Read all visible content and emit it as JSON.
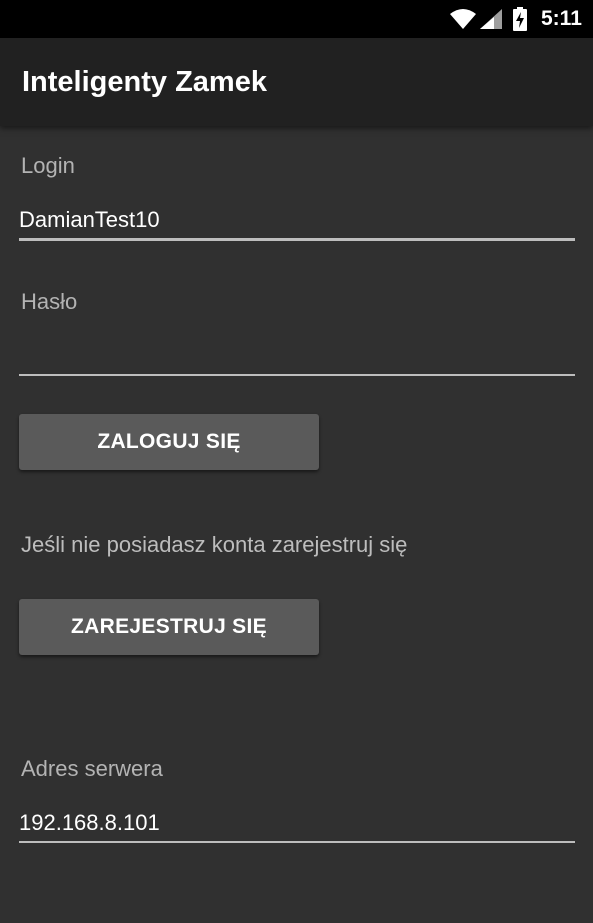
{
  "status_bar": {
    "time": "5:11",
    "icons": [
      "wifi-icon",
      "signal-icon",
      "battery-charging-icon"
    ]
  },
  "app_bar": {
    "title": "Inteligenty Zamek"
  },
  "login_form": {
    "login_label": "Login",
    "login_value": "DamianTest10",
    "password_label": "Hasło",
    "password_value": "",
    "login_button": "ZALOGUJ SIĘ"
  },
  "register": {
    "info_text": "Jeśli nie posiadasz konta zarejestruj się",
    "register_button": "ZAREJESTRUJ SIĘ"
  },
  "server": {
    "label": "Adres serwera",
    "value": "192.168.8.101"
  },
  "colors": {
    "background": "#303030",
    "app_bar": "#212121",
    "status_bar": "#000000",
    "button": "#5a5a5a",
    "text": "#ffffff",
    "hint": "#b3b3b3"
  }
}
